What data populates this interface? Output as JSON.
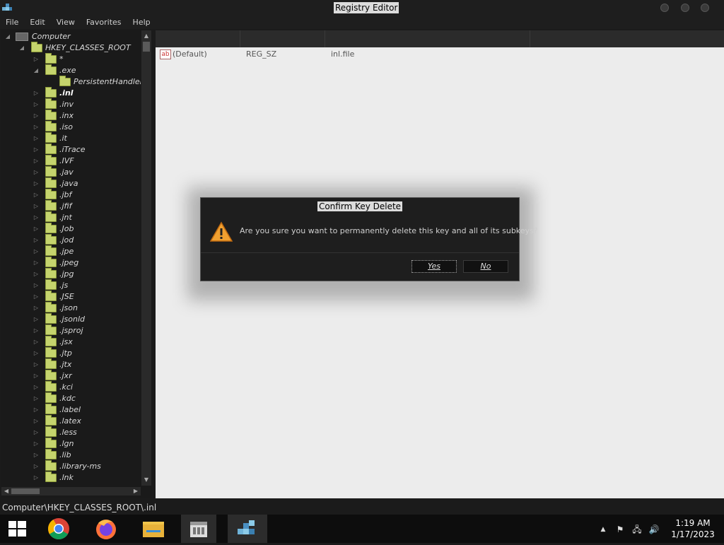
{
  "window": {
    "title": "Registry Editor"
  },
  "menu": [
    "File",
    "Edit",
    "View",
    "Favorites",
    "Help"
  ],
  "tree": {
    "root": "Computer",
    "hive": "HKEY_CLASSES_ROOT",
    "items": [
      {
        "label": "*",
        "level": 2
      },
      {
        "label": ".exe",
        "level": 2,
        "expanded": true
      },
      {
        "label": "PersistentHandler",
        "level": 3
      },
      {
        "label": ".inl",
        "level": 2,
        "selected": true
      },
      {
        "label": ".inv",
        "level": 2
      },
      {
        "label": ".inx",
        "level": 2
      },
      {
        "label": ".iso",
        "level": 2
      },
      {
        "label": ".it",
        "level": 2
      },
      {
        "label": ".iTrace",
        "level": 2
      },
      {
        "label": ".IVF",
        "level": 2
      },
      {
        "label": ".jav",
        "level": 2
      },
      {
        "label": ".java",
        "level": 2
      },
      {
        "label": ".jbf",
        "level": 2
      },
      {
        "label": ".jfif",
        "level": 2
      },
      {
        "label": ".jnt",
        "level": 2
      },
      {
        "label": ".Job",
        "level": 2
      },
      {
        "label": ".jod",
        "level": 2
      },
      {
        "label": ".jpe",
        "level": 2
      },
      {
        "label": ".jpeg",
        "level": 2
      },
      {
        "label": ".jpg",
        "level": 2
      },
      {
        "label": ".js",
        "level": 2
      },
      {
        "label": ".JSE",
        "level": 2
      },
      {
        "label": ".json",
        "level": 2
      },
      {
        "label": ".jsonld",
        "level": 2
      },
      {
        "label": ".jsproj",
        "level": 2
      },
      {
        "label": ".jsx",
        "level": 2
      },
      {
        "label": ".jtp",
        "level": 2
      },
      {
        "label": ".jtx",
        "level": 2
      },
      {
        "label": ".jxr",
        "level": 2
      },
      {
        "label": ".kci",
        "level": 2
      },
      {
        "label": ".kdc",
        "level": 2
      },
      {
        "label": ".label",
        "level": 2
      },
      {
        "label": ".latex",
        "level": 2
      },
      {
        "label": ".less",
        "level": 2
      },
      {
        "label": ".lgn",
        "level": 2
      },
      {
        "label": ".lib",
        "level": 2
      },
      {
        "label": ".library-ms",
        "level": 2
      },
      {
        "label": ".lnk",
        "level": 2
      }
    ]
  },
  "values": [
    {
      "name": "(Default)",
      "type": "REG_SZ",
      "data": "inl.file"
    }
  ],
  "dialog": {
    "title": "Confirm Key Delete",
    "message": "Are you sure you want to permanently delete this key and all of its subkeys?",
    "yes": "Yes",
    "no": "No"
  },
  "status": "Computer\\HKEY_CLASSES_ROOT\\.inl",
  "taskbar": {
    "time": "1:19 AM",
    "date": "1/17/2023",
    "apps": [
      "start-icon",
      "chrome-icon",
      "firefox-icon",
      "file-explorer-icon",
      "store-icon",
      "registry-editor-icon"
    ]
  }
}
